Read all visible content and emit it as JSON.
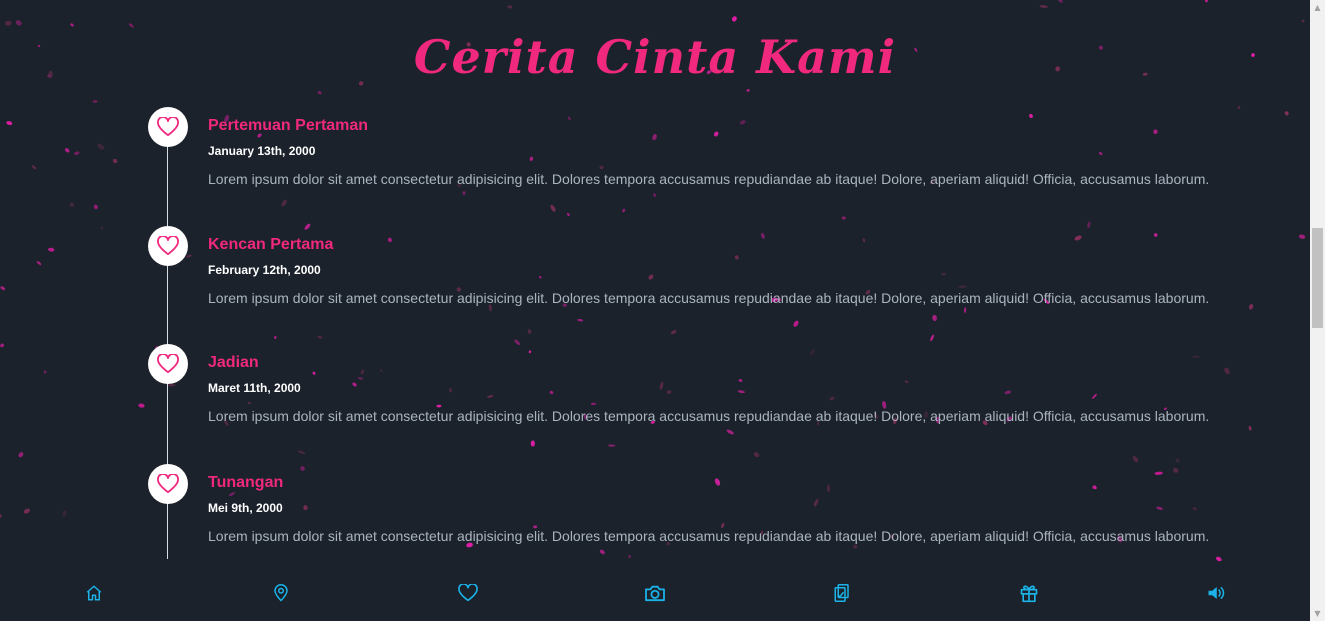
{
  "page": {
    "title": "Cerita Cinta Kami"
  },
  "timeline": [
    {
      "title": "Pertemuan Pertaman",
      "date": "January 13th, 2000",
      "description": "Lorem ipsum dolor sit amet consectetur adipisicing elit. Dolores tempora accusamus repudiandae ab itaque! Dolore, aperiam aliquid! Officia, accusamus laborum.",
      "icon": "heart-icon"
    },
    {
      "title": "Kencan Pertama",
      "date": "February 12th, 2000",
      "description": "Lorem ipsum dolor sit amet consectetur adipisicing elit. Dolores tempora accusamus repudiandae ab itaque! Dolore, aperiam aliquid! Officia, accusamus laborum.",
      "icon": "heart-icon"
    },
    {
      "title": "Jadian",
      "date": "Maret 11th, 2000",
      "description": "Lorem ipsum dolor sit amet consectetur adipisicing elit. Dolores tempora accusamus repudiandae ab itaque! Dolore, aperiam aliquid! Officia, accusamus laborum.",
      "icon": "heart-icon"
    },
    {
      "title": "Tunangan",
      "date": "Mei 9th, 2000",
      "description": "Lorem ipsum dolor sit amet consectetur adipisicing elit. Dolores tempora accusamus repudiandae ab itaque! Dolore, aperiam aliquid! Officia, accusamus laborum.",
      "icon": "heart-icon"
    }
  ],
  "bottom_nav": [
    {
      "icon": "home-icon"
    },
    {
      "icon": "location-pin-icon"
    },
    {
      "icon": "heart-icon"
    },
    {
      "icon": "camera-icon"
    },
    {
      "icon": "clipboard-check-icon"
    },
    {
      "icon": "gift-icon"
    },
    {
      "icon": "volume-icon"
    }
  ],
  "colors": {
    "background": "#1b222b",
    "accent_pink": "#f0287e",
    "nav_blue": "#1bb3e8",
    "text_muted": "#aab4bf"
  }
}
